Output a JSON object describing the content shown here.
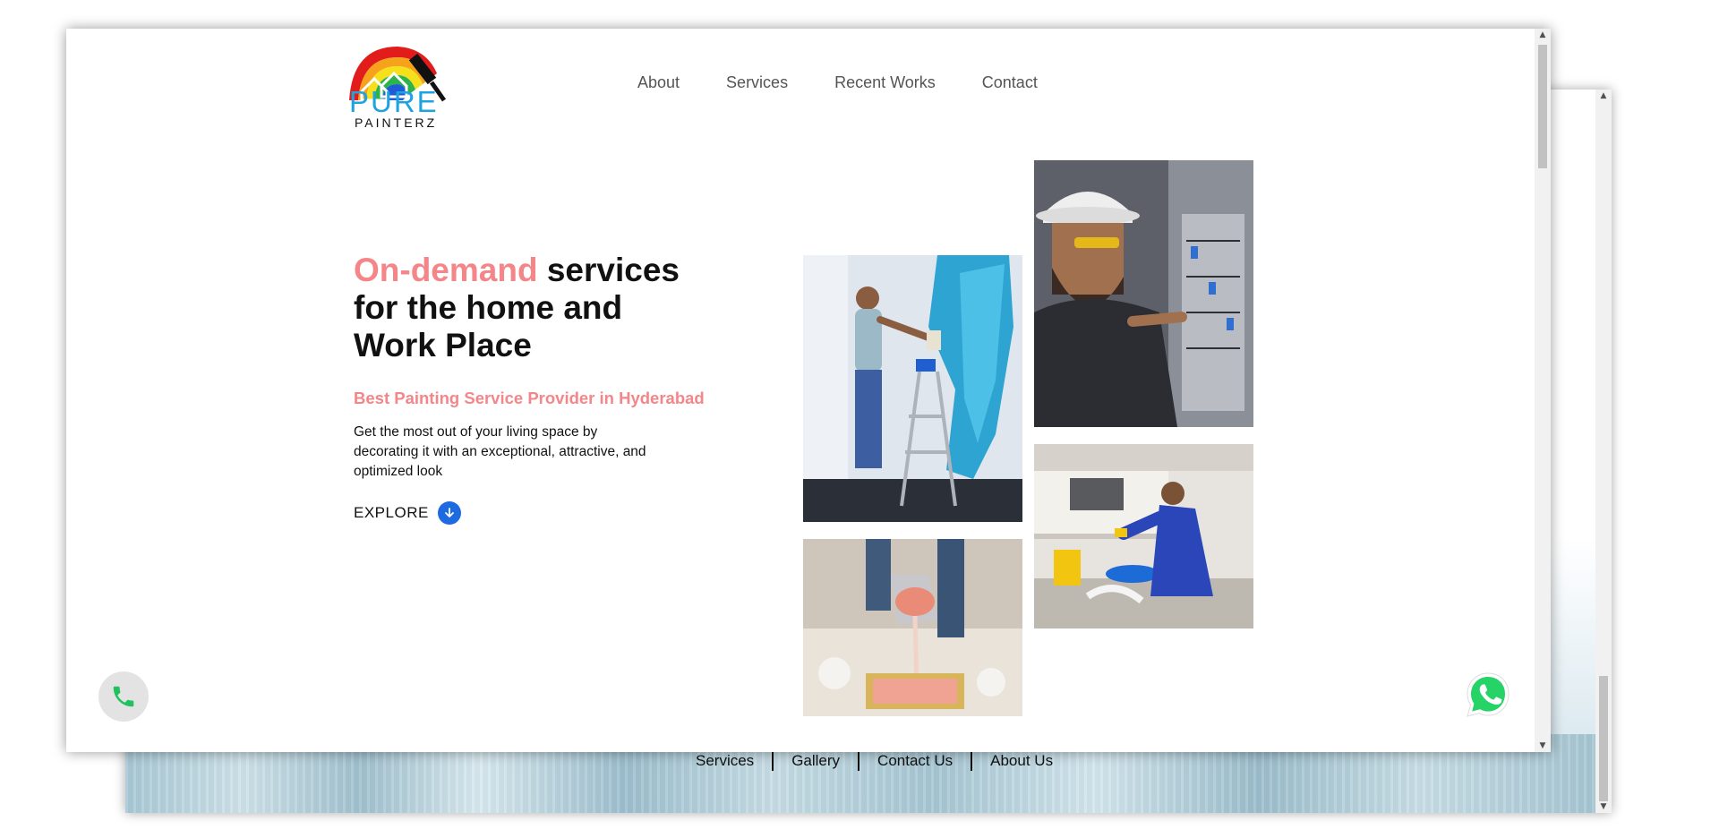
{
  "brand": {
    "name_top": "PURE",
    "name_bottom": "PAINTERZ"
  },
  "nav": {
    "items": [
      {
        "label": "About"
      },
      {
        "label": "Services"
      },
      {
        "label": "Recent Works"
      },
      {
        "label": "Contact"
      }
    ]
  },
  "hero": {
    "title_accent": "On-demand",
    "title_rest_1": " services",
    "title_line_2": "for the home and",
    "title_line_3": "Work Place",
    "subtitle": "Best Painting Service Provider in Hyderabad",
    "description": "Get the most out of your living space by decorating it with an exceptional, attractive, and optimized look",
    "explore_label": "EXPLORE"
  },
  "gallery": [
    {
      "icon": "painter-roller-photo"
    },
    {
      "icon": "electrician-photo"
    },
    {
      "icon": "paint-pouring-photo"
    },
    {
      "icon": "plumber-photo"
    }
  ],
  "floating": {
    "call_icon": "phone-icon",
    "whatsapp_icon": "whatsapp-icon"
  },
  "footer": {
    "links": [
      {
        "label": "Services"
      },
      {
        "label": "Gallery"
      },
      {
        "label": "Contact Us"
      },
      {
        "label": "About Us"
      }
    ]
  },
  "colors": {
    "accent": "#f4868a",
    "logo_blue": "#1fa3e0",
    "explore_blue": "#1e6ae0",
    "whatsapp_green": "#25d366"
  }
}
